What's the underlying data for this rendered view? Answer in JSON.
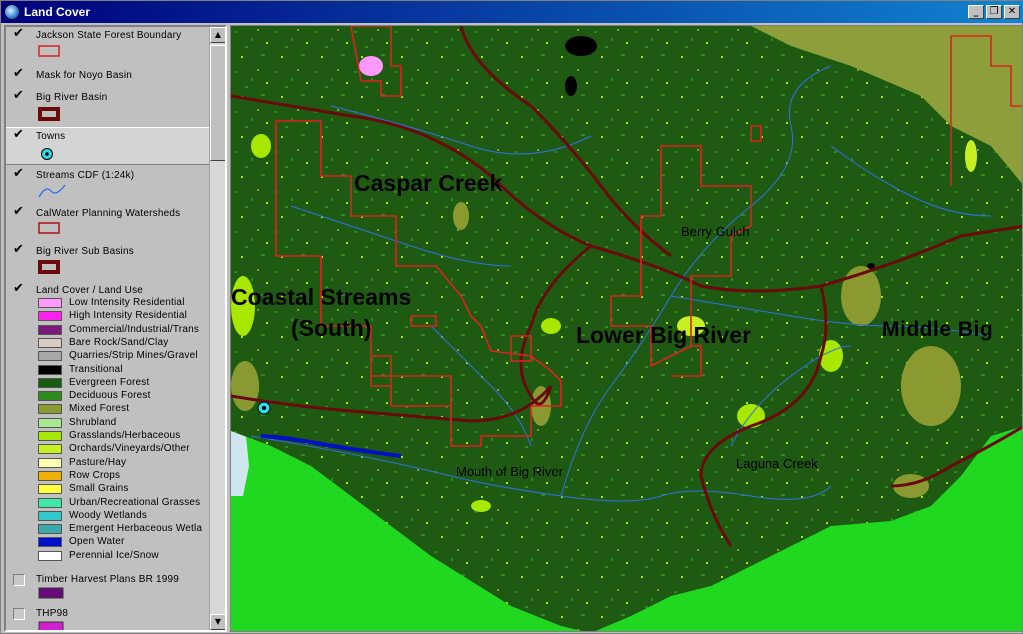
{
  "window": {
    "title": "Land Cover",
    "buttons": {
      "minimize": "_",
      "restore": "❐",
      "close": "✕"
    }
  },
  "toc": {
    "layers": [
      {
        "name": "Jackson State Forest Boundary",
        "checked": true
      },
      {
        "name": "Mask for Noyo Basin",
        "checked": true
      },
      {
        "name": "Big River Basin",
        "checked": true
      },
      {
        "name": "Towns",
        "checked": true
      },
      {
        "name": "Streams CDF (1:24k)",
        "checked": true
      },
      {
        "name": "CalWater Planning Watersheds",
        "checked": true
      },
      {
        "name": "Big River Sub Basins",
        "checked": true
      },
      {
        "name": "Land Cover / Land Use",
        "checked": true
      },
      {
        "name": "Timber Harvest Plans BR 1999",
        "checked": false
      },
      {
        "name": "THP98",
        "checked": false
      }
    ],
    "landcover_classes": [
      {
        "label": "Low Intensity Residential",
        "color": "#ff99ff"
      },
      {
        "label": "High Intensity Residential",
        "color": "#ff22ee"
      },
      {
        "label": "Commercial/Industrial/Trans",
        "color": "#7a1a7a"
      },
      {
        "label": "Bare Rock/Sand/Clay",
        "color": "#d8ccc0"
      },
      {
        "label": "Quarries/Strip Mines/Gravel",
        "color": "#a8a8a8"
      },
      {
        "label": "Transitional",
        "color": "#000000"
      },
      {
        "label": "Evergreen Forest",
        "color": "#155c10"
      },
      {
        "label": "Deciduous Forest",
        "color": "#2e8a1e"
      },
      {
        "label": "Mixed Forest",
        "color": "#8a9a30"
      },
      {
        "label": "Shrubland",
        "color": "#a8e890"
      },
      {
        "label": "Grasslands/Herbaceous",
        "color": "#a8e800"
      },
      {
        "label": "Orchards/Vineyards/Other",
        "color": "#c8f020"
      },
      {
        "label": "Pasture/Hay",
        "color": "#ffffb0"
      },
      {
        "label": "Row Crops",
        "color": "#f0b000"
      },
      {
        "label": "Small Grains",
        "color": "#ffff40"
      },
      {
        "label": "Urban/Recreational Grasses",
        "color": "#40e8a8"
      },
      {
        "label": "Woody Wetlands",
        "color": "#30c8c8"
      },
      {
        "label": "Emergent Herbaceous Wetla",
        "color": "#38a8a8"
      },
      {
        "label": "Open Water",
        "color": "#0010c8"
      },
      {
        "label": "Perennial Ice/Snow",
        "color": "#ffffff"
      }
    ],
    "colors": {
      "boundary_red": "#e02020",
      "sub_basin": "#6a0a0a",
      "town_cyan": "#30d8e8",
      "stream_blue": "#3070e8",
      "timber_harvest": "#6a0a7a",
      "thp98": "#d020d0"
    }
  },
  "map": {
    "labels": {
      "caspar": "Caspar Creek",
      "coastal1": "Coastal Streams",
      "coastal2": "(South)",
      "lower_big": "Lower Big River",
      "middle_big": "Middle Big",
      "berry": "Berry Gulch",
      "mouth": "Mouth of Big River",
      "laguna": "Laguna Creek"
    },
    "colors": {
      "evergreen": "#1e5a12",
      "deciduous": "#2e8a1e",
      "grass": "#a8e800",
      "mixed": "#8a9a30",
      "outside": "#1fd81f",
      "olive": "#8e9e3a",
      "ocean": "#d0e6ee"
    }
  }
}
